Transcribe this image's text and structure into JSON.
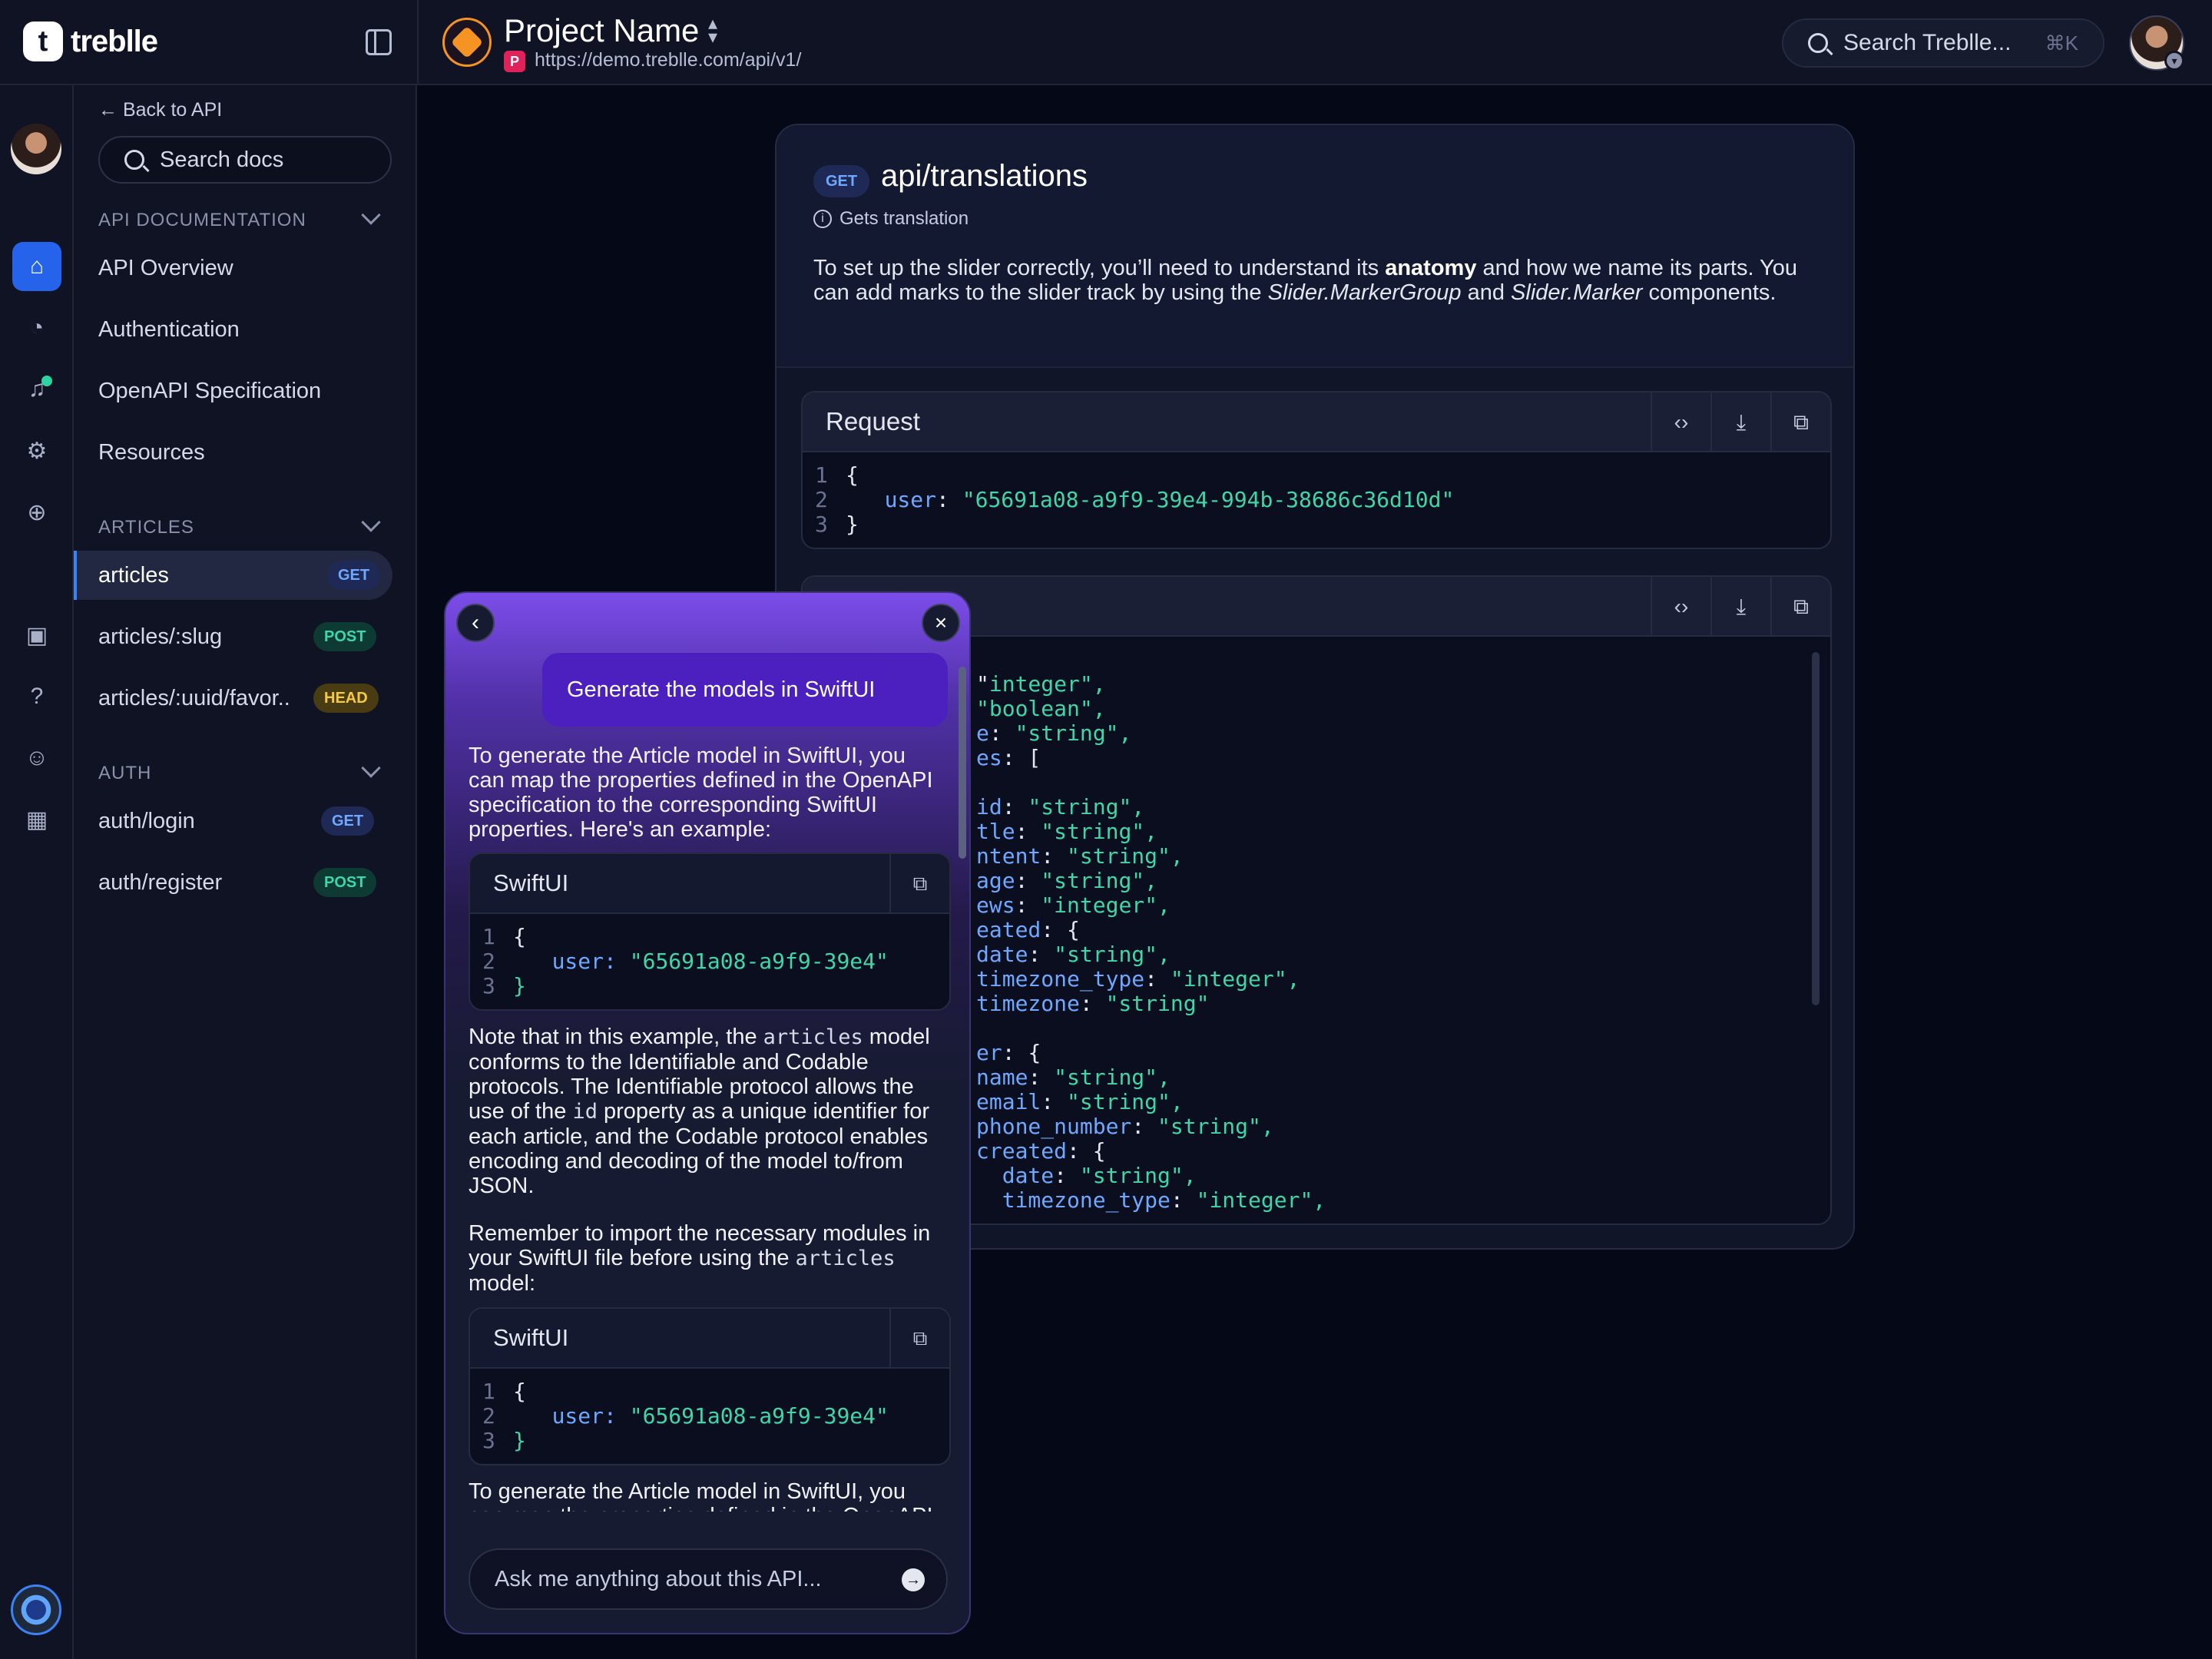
{
  "brand": {
    "name": "treblle",
    "mark": "t"
  },
  "header": {
    "project_name": "Project Name",
    "project_badge": "P",
    "project_url": "https://demo.treblle.com/api/v1/",
    "search_placeholder": "Search Treblle...",
    "search_shortcut": "⌘K"
  },
  "docs": {
    "back_label": "Back to API",
    "search_placeholder": "Search docs",
    "sections": [
      {
        "title": "API DOCUMENTATION",
        "items": [
          "API Overview",
          "Authentication",
          "OpenAPI Specification",
          "Resources"
        ]
      },
      {
        "title": "ARTICLES",
        "items": [
          {
            "label": "articles",
            "method": "GET"
          },
          {
            "label": "articles/:slug",
            "method": "POST"
          },
          {
            "label": "articles/:uuid/favor..",
            "method": "HEAD"
          }
        ]
      },
      {
        "title": "AUTH",
        "items": [
          {
            "label": "auth/login",
            "method": "GET"
          },
          {
            "label": "auth/register",
            "method": "POST"
          }
        ]
      }
    ]
  },
  "endpoint": {
    "method": "GET",
    "path": "api/translations",
    "summary": "Gets translation",
    "description_1": "To set up the slider correctly, you’ll need to understand its ",
    "description_bold": "anatomy",
    "description_2": " and how we name its parts. You can add marks to the slider track by using the ",
    "description_em1": "Slider.MarkerGroup",
    "description_3": " and ",
    "description_em2": "Slider.Marker",
    "description_4": " components."
  },
  "request": {
    "title": "Request",
    "line_numbers": [
      "1",
      "2",
      "3"
    ],
    "open": "{",
    "key": "user",
    "value": "\"65691a08-a9f9-39e4-994b-38686c36d10d\"",
    "close": "}"
  },
  "response": {
    "lines": [
      {
        "k": "",
        "v": "integer\",",
        "pre": "\""
      },
      {
        "k": "",
        "v": "\"boolean\",",
        "pre": ""
      },
      {
        "k": "e",
        "v": "\"string\",",
        "pre": ": "
      },
      {
        "k": "es",
        "v": "[",
        "pre": ": "
      },
      {
        "k": "",
        "v": "",
        "pre": ""
      },
      {
        "k": "id",
        "v": "\"string\",",
        "pre": ": "
      },
      {
        "k": "tle",
        "v": "\"string\",",
        "pre": ": "
      },
      {
        "k": "ntent",
        "v": "\"string\",",
        "pre": ": "
      },
      {
        "k": "age",
        "v": "\"string\",",
        "pre": ": "
      },
      {
        "k": "ews",
        "v": "\"integer\",",
        "pre": ": "
      },
      {
        "k": "eated",
        "v": "{",
        "pre": ": "
      },
      {
        "k": "date",
        "v": "\"string\",",
        "pre": ": "
      },
      {
        "k": "timezone_type",
        "v": "\"integer\",",
        "pre": ": "
      },
      {
        "k": "timezone",
        "v": "\"string\"",
        "pre": ": "
      },
      {
        "k": "",
        "v": "",
        "pre": ""
      },
      {
        "k": "er",
        "v": "{",
        "pre": ": "
      },
      {
        "k": "name",
        "v": "\"string\",",
        "pre": ": "
      },
      {
        "k": "email",
        "v": "\"string\",",
        "pre": ": "
      },
      {
        "k": "phone_number",
        "v": "\"string\",",
        "pre": ": "
      },
      {
        "k": "created",
        "v": "{",
        "pre": ": "
      },
      {
        "k": "  date",
        "v": "\"string\",",
        "pre": ": "
      },
      {
        "k": "  timezone_type",
        "v": "\"integer\",",
        "pre": ": "
      }
    ]
  },
  "chat": {
    "user_prompt": "Generate the models in SwiftUI",
    "reply_1": "To generate the Article model in SwiftUI, you can map the properties defined in the OpenAPI specification to the corresponding SwiftUI properties. Here's an example:",
    "code_title": "SwiftUI",
    "code_key": "user:",
    "code_value": "\"65691a08-a9f9-39e4\"",
    "reply_2a": "Note that in this example, the ",
    "reply_2code1": "articles",
    "reply_2b": " model conforms to the Identifiable and Codable protocols. The Identifiable protocol allows the use of the ",
    "reply_2code2": "id",
    "reply_2c": " property as a unique identifier for each article, and the Codable protocol enables encoding and decoding of the model to/from JSON.",
    "reply_3a": "Remember to import the necessary modules in your SwiftUI file before using the ",
    "reply_3code": "articles",
    "reply_3b": " model:",
    "reply_4": "To generate the Article model in SwiftUI, you can map the properties defined in the OpenAPI",
    "input_placeholder": "Ask me anything about this API..."
  },
  "colors": {
    "accent": "#2563eb",
    "get": "#6ea8ff",
    "post": "#3fd6a8",
    "head": "#f6c945",
    "string": "#3fd6a8",
    "key": "#6ea8ff"
  }
}
